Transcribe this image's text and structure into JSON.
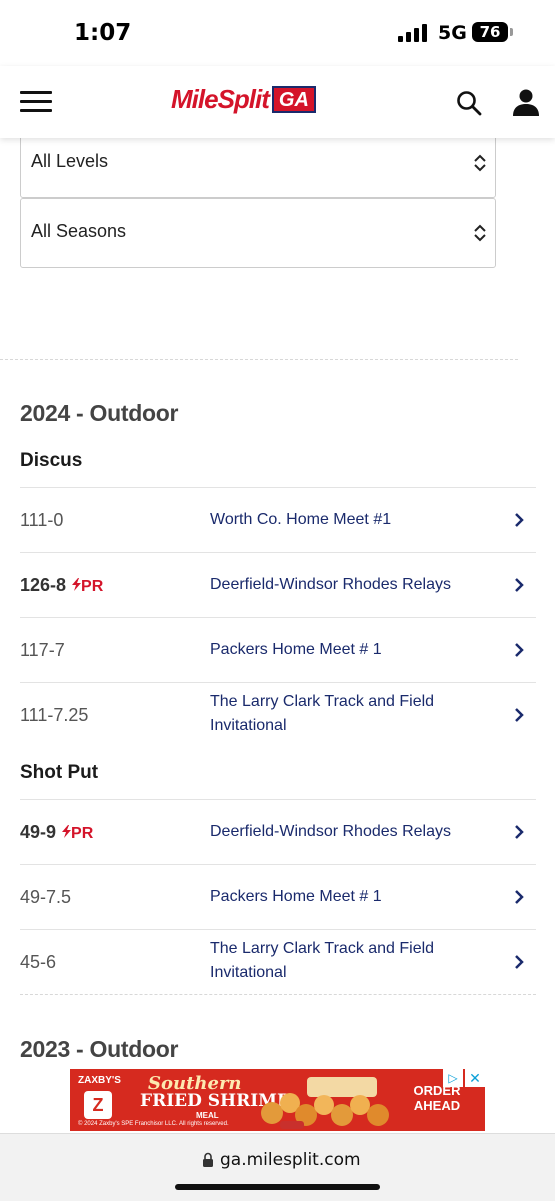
{
  "status_bar": {
    "time": "1:07",
    "network": "5G",
    "battery": "76"
  },
  "header": {
    "logo_text": "MileSplit",
    "logo_badge": "GA"
  },
  "filters": {
    "level": "All Levels",
    "season": "All Seasons"
  },
  "seasons": [
    {
      "title": "2024 - Outdoor",
      "events": [
        {
          "name": "Discus",
          "results": [
            {
              "mark": "111-0",
              "pr": "",
              "meet": "Worth Co. Home Meet #1"
            },
            {
              "mark": "126-8",
              "pr": "PR",
              "meet": "Deerfield-Windsor Rhodes Relays"
            },
            {
              "mark": "117-7",
              "pr": "",
              "meet": "Packers Home Meet # 1"
            },
            {
              "mark": "111-7.25",
              "pr": "",
              "meet": "The Larry Clark Track and Field Invitational"
            }
          ]
        },
        {
          "name": "Shot Put",
          "results": [
            {
              "mark": "49-9",
              "pr": "PR",
              "meet": "Deerfield-Windsor Rhodes Relays"
            },
            {
              "mark": "49-7.5",
              "pr": "",
              "meet": "Packers Home Meet # 1"
            },
            {
              "mark": "45-6",
              "pr": "",
              "meet": "The Larry Clark Track and Field Invitational"
            }
          ]
        }
      ]
    },
    {
      "title": "2023 - Outdoor",
      "events": []
    }
  ],
  "ad": {
    "brand": "ZAXBY'S",
    "line1": "Southern",
    "line2": "FRIED SHRIMP",
    "line3": "MEAL",
    "cta": "ORDER AHEAD",
    "fine_print": "© 2024 Zaxby's SPE Franchisor LLC. All rights reserved.",
    "adchoices_icon": "adchoices-icon",
    "close_icon": "close-icon"
  },
  "browser": {
    "url": "ga.milesplit.com"
  },
  "colors": {
    "brand_red": "#d4142a",
    "link_navy": "#1a2a6c"
  }
}
